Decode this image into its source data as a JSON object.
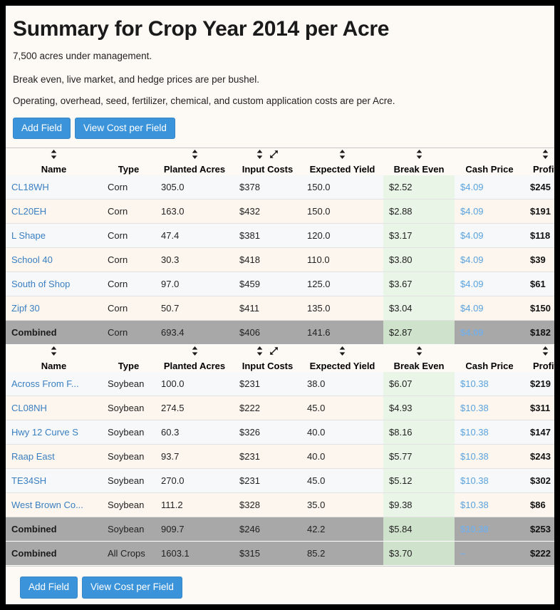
{
  "header": {
    "title": "Summary for Crop Year 2014 per Acre",
    "notes": [
      "7,500 acres under management.",
      "Break even, live market, and hedge prices are per bushel.",
      "Operating, overhead, seed, fertilizer, chemical, and custom application costs are per Acre."
    ]
  },
  "actions": {
    "add_field": "Add Field",
    "view_cost_per_field": "View Cost per Field"
  },
  "columns": [
    {
      "key": "name",
      "label": "Name",
      "sortable": true,
      "expandable": false,
      "highlight": false
    },
    {
      "key": "type",
      "label": "Type",
      "sortable": false,
      "expandable": false,
      "highlight": false
    },
    {
      "key": "acres",
      "label": "Planted Acres",
      "sortable": true,
      "expandable": false,
      "highlight": false
    },
    {
      "key": "input",
      "label": "Input Costs",
      "sortable": true,
      "expandable": true,
      "highlight": false
    },
    {
      "key": "yield",
      "label": "Expected Yield",
      "sortable": true,
      "expandable": false,
      "highlight": false
    },
    {
      "key": "break",
      "label": "Break Even",
      "sortable": true,
      "expandable": false,
      "highlight": true
    },
    {
      "key": "cash",
      "label": "Cash Price",
      "sortable": false,
      "expandable": false,
      "highlight": false
    },
    {
      "key": "profit",
      "label": "Profit",
      "sortable": true,
      "expandable": false,
      "highlight": false
    }
  ],
  "sections": [
    {
      "id": "corn",
      "rows": [
        {
          "name": "CL18WH",
          "type": "Corn",
          "acres": "305.0",
          "input": "$378",
          "yield": "150.0",
          "break": "$2.52",
          "cash": "$4.09",
          "profit": "$245",
          "combined": false
        },
        {
          "name": "CL20EH",
          "type": "Corn",
          "acres": "163.0",
          "input": "$432",
          "yield": "150.0",
          "break": "$2.88",
          "cash": "$4.09",
          "profit": "$191",
          "combined": false
        },
        {
          "name": "L Shape",
          "type": "Corn",
          "acres": "47.4",
          "input": "$381",
          "yield": "120.0",
          "break": "$3.17",
          "cash": "$4.09",
          "profit": "$118",
          "combined": false
        },
        {
          "name": "School 40",
          "type": "Corn",
          "acres": "30.3",
          "input": "$418",
          "yield": "110.0",
          "break": "$3.80",
          "cash": "$4.09",
          "profit": "$39",
          "combined": false
        },
        {
          "name": "South of Shop",
          "type": "Corn",
          "acres": "97.0",
          "input": "$459",
          "yield": "125.0",
          "break": "$3.67",
          "cash": "$4.09",
          "profit": "$61",
          "combined": false
        },
        {
          "name": "Zipf 30",
          "type": "Corn",
          "acres": "50.7",
          "input": "$411",
          "yield": "135.0",
          "break": "$3.04",
          "cash": "$4.09",
          "profit": "$150",
          "combined": false
        },
        {
          "name": "Combined",
          "type": "Corn",
          "acres": "693.4",
          "input": "$406",
          "yield": "141.6",
          "break": "$2.87",
          "cash": "$4.09",
          "profit": "$182",
          "combined": true
        }
      ]
    },
    {
      "id": "soybean",
      "rows": [
        {
          "name": "Across From F...",
          "type": "Soybean",
          "acres": "100.0",
          "input": "$231",
          "yield": "38.0",
          "break": "$6.07",
          "cash": "$10.38",
          "profit": "$219",
          "combined": false
        },
        {
          "name": "CL08NH",
          "type": "Soybean",
          "acres": "274.5",
          "input": "$222",
          "yield": "45.0",
          "break": "$4.93",
          "cash": "$10.38",
          "profit": "$311",
          "combined": false
        },
        {
          "name": "Hwy 12 Curve S",
          "type": "Soybean",
          "acres": "60.3",
          "input": "$326",
          "yield": "40.0",
          "break": "$8.16",
          "cash": "$10.38",
          "profit": "$147",
          "combined": false
        },
        {
          "name": "Raap East",
          "type": "Soybean",
          "acres": "93.7",
          "input": "$231",
          "yield": "40.0",
          "break": "$5.77",
          "cash": "$10.38",
          "profit": "$243",
          "combined": false
        },
        {
          "name": "TE34SH",
          "type": "Soybean",
          "acres": "270.0",
          "input": "$231",
          "yield": "45.0",
          "break": "$5.12",
          "cash": "$10.38",
          "profit": "$302",
          "combined": false
        },
        {
          "name": "West Brown Co...",
          "type": "Soybean",
          "acres": "111.2",
          "input": "$328",
          "yield": "35.0",
          "break": "$9.38",
          "cash": "$10.38",
          "profit": "$86",
          "combined": false
        },
        {
          "name": "Combined",
          "type": "Soybean",
          "acres": "909.7",
          "input": "$246",
          "yield": "42.2",
          "break": "$5.84",
          "cash": "$10.38",
          "profit": "$253",
          "combined": true
        },
        {
          "name": "Combined",
          "type": "All Crops",
          "acres": "1603.1",
          "input": "$315",
          "yield": "85.2",
          "break": "$3.70",
          "cash": "–",
          "profit": "$222",
          "combined": true
        }
      ]
    }
  ],
  "colors": {
    "accent_blue": "#3b93d9",
    "link_blue": "#3a7fc1",
    "cash_blue": "#5aa2de",
    "highlight_header_green": "#d9e8d6",
    "highlight_cell_green": "#e9f5e6",
    "combined_gray": "#a8a8a8",
    "page_bg": "#fdfaf5"
  }
}
